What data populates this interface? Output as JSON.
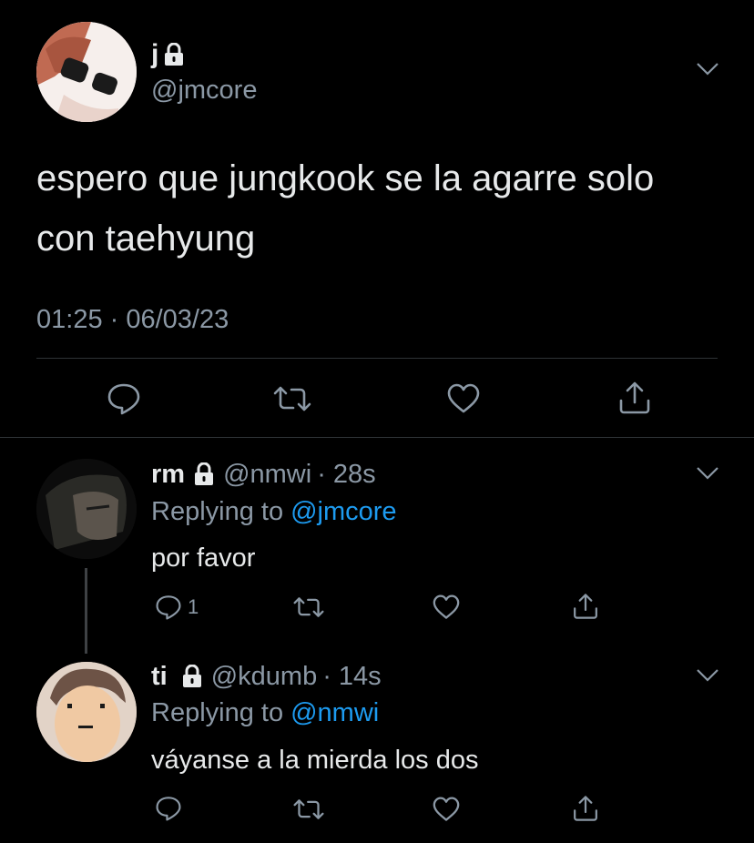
{
  "main_tweet": {
    "display_name": "j",
    "handle": "@jmcore",
    "text_line1": "espero que jungkook se la agarre solo",
    "text_line2": "con taehyung",
    "timestamp": "01:25 · 06/03/23"
  },
  "replies": [
    {
      "display_name": "rm",
      "handle": "@nmwi",
      "age": "· 28s",
      "replying_to_prefix": "Replying to",
      "replying_to_handle": "@jmcore",
      "text": "por favor",
      "reply_count": "1"
    },
    {
      "display_name": "ti",
      "handle": "@kdumb",
      "age": "· 14s",
      "replying_to_prefix": "Replying to",
      "replying_to_handle": "@nmwi",
      "text": "váyanse a la mierda los dos",
      "reply_count": ""
    }
  ],
  "icons": [
    "lock-icon",
    "chevron-down-icon",
    "reply-icon",
    "retweet-icon",
    "like-icon",
    "share-icon"
  ],
  "colors": {
    "background": "#000000",
    "text": "#e7e9ea",
    "muted": "#8b98a5",
    "link": "#1d9bf0",
    "divider": "#2f3336"
  }
}
